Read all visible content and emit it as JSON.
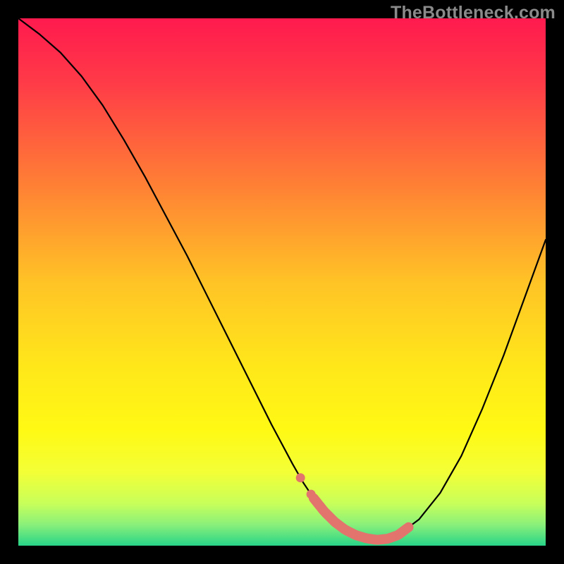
{
  "watermark": "TheBottleneck.com",
  "chart_data": {
    "type": "line",
    "title": "",
    "xlabel": "",
    "ylabel": "",
    "xlim": [
      0,
      100
    ],
    "ylim": [
      0,
      100
    ],
    "grid": false,
    "series": [
      {
        "name": "bottleneck-curve",
        "x": [
          0,
          4,
          8,
          12,
          16,
          20,
          24,
          28,
          32,
          36,
          40,
          44,
          48,
          52,
          54,
          56,
          58,
          60,
          62,
          64,
          66,
          68,
          70,
          72,
          76,
          80,
          84,
          88,
          92,
          96,
          100
        ],
        "y": [
          100,
          97,
          93.5,
          89,
          83.5,
          77,
          70,
          62.5,
          55,
          47,
          39,
          31,
          23,
          15.5,
          12,
          9,
          6.5,
          4.5,
          3,
          2,
          1.4,
          1.1,
          1.3,
          2,
          5,
          10,
          17,
          26,
          36,
          47,
          58
        ]
      }
    ],
    "highlight_band": {
      "name": "optimal-zone",
      "x_start": 56,
      "x_end": 74,
      "color": "#e2746d"
    },
    "gradient_stops": [
      {
        "offset": 0.0,
        "color": "#ff1a4e"
      },
      {
        "offset": 0.12,
        "color": "#ff3a48"
      },
      {
        "offset": 0.3,
        "color": "#ff7a36"
      },
      {
        "offset": 0.5,
        "color": "#ffc326"
      },
      {
        "offset": 0.66,
        "color": "#ffe71a"
      },
      {
        "offset": 0.78,
        "color": "#fff914"
      },
      {
        "offset": 0.86,
        "color": "#f3ff36"
      },
      {
        "offset": 0.92,
        "color": "#c8ff5a"
      },
      {
        "offset": 0.96,
        "color": "#8af07a"
      },
      {
        "offset": 1.0,
        "color": "#28d488"
      }
    ]
  }
}
